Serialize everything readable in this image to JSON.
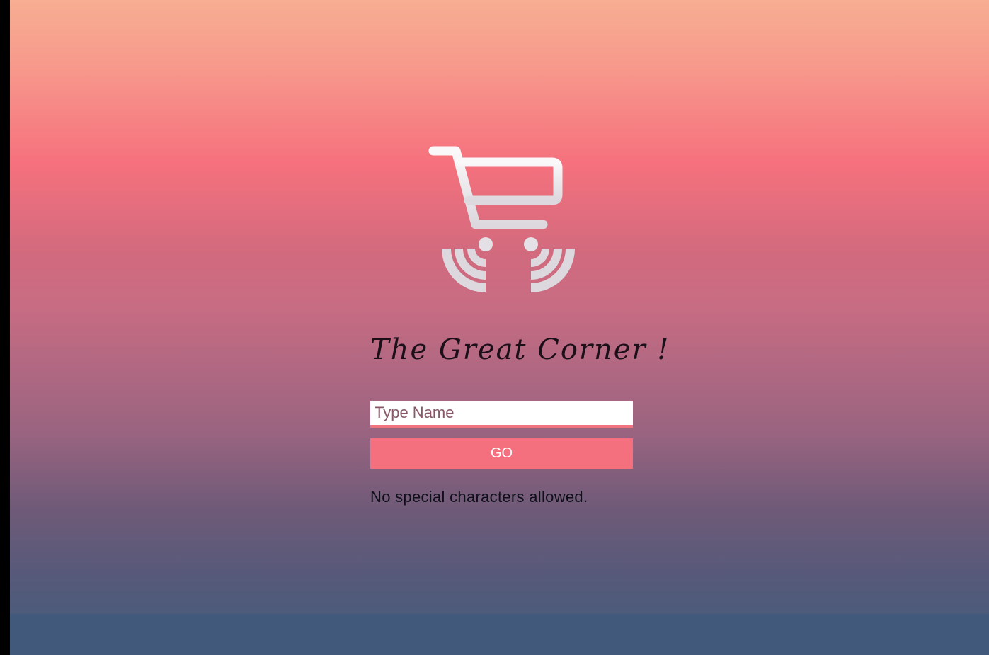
{
  "app": {
    "title": "The Great Corner !"
  },
  "form": {
    "name_placeholder": "Type Name",
    "name_value": "",
    "go_label": "GO",
    "hint": "No special characters allowed."
  },
  "icons": {
    "logo": "shopping-cart-wifi-icon"
  },
  "colors": {
    "accent": "#f4707f",
    "logo": "#e6e2e6",
    "text_dark": "#0f0f1a"
  }
}
